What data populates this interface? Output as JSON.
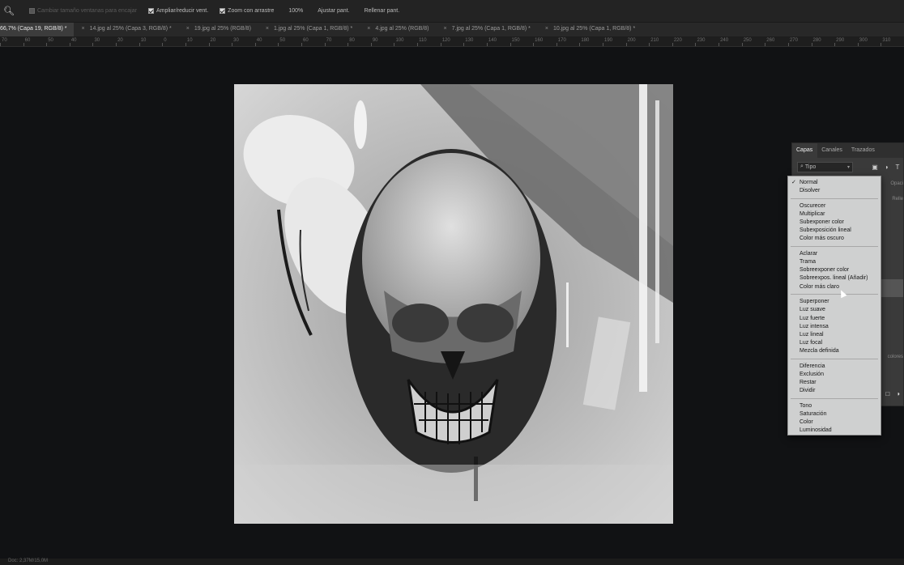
{
  "options_bar": {
    "items": [
      {
        "label": "Cambiar tamaño ventanas para encajar",
        "checked": false,
        "dimmed": true
      },
      {
        "label": "Ampliar/reducir vent.",
        "checked": true,
        "dimmed": false
      },
      {
        "label": "Zoom con arrastre",
        "checked": true,
        "dimmed": false
      }
    ],
    "buttons": [
      "100%",
      "Ajustar pant.",
      "Rellenar pant."
    ]
  },
  "document_tabs": [
    {
      "label": "66,7% (Capa 19, RGB/8) *",
      "active": true
    },
    {
      "label": "14.jpg al 25% (Capa 3, RGB/8) *",
      "active": false
    },
    {
      "label": "19.jpg al 25% (RGB/8)",
      "active": false
    },
    {
      "label": "1.jpg al 25% (Capa 1, RGB/8) *",
      "active": false
    },
    {
      "label": "4.jpg al 25% (RGB/8)",
      "active": false
    },
    {
      "label": "7.jpg al 25% (Capa 1, RGB/8) *",
      "active": false
    },
    {
      "label": "10.jpg al 25% (Capa 1, RGB/8) *",
      "active": false
    }
  ],
  "ruler_labels": [
    "70",
    "60",
    "50",
    "40",
    "30",
    "20",
    "10",
    "0",
    "10",
    "20",
    "30",
    "40",
    "50",
    "60",
    "70",
    "80",
    "90",
    "100",
    "110",
    "120",
    "130",
    "140",
    "150",
    "160",
    "170",
    "180",
    "190",
    "200",
    "210",
    "220",
    "230",
    "240",
    "250",
    "260",
    "270",
    "280",
    "290",
    "300",
    "310"
  ],
  "layers_panel": {
    "tabs": [
      "Capas",
      "Canales",
      "Trazados"
    ],
    "filter_label": "Tipo",
    "opacity_label": "Opaci",
    "fill_label": "Relle",
    "colors_label": "colores"
  },
  "blend_menu": {
    "selected": "Normal",
    "groups": [
      [
        "Normal",
        "Disolver"
      ],
      [
        "Oscurecer",
        "Multiplicar",
        "Subexponer color",
        "Subexposición lineal",
        "Color más oscuro"
      ],
      [
        "Aclarar",
        "Trama",
        "Sobreexponer color",
        "Sobreexpos. lineal (Añadir)",
        "Color más claro"
      ],
      [
        "Superponer",
        "Luz suave",
        "Luz fuerte",
        "Luz intensa",
        "Luz lineal",
        "Luz focal",
        "Mezcla definida"
      ],
      [
        "Diferencia",
        "Exclusión",
        "Restar",
        "Dividir"
      ],
      [
        "Tono",
        "Saturación",
        "Color",
        "Luminosidad"
      ]
    ]
  },
  "status": {
    "text": "Doc: 2,37M/15,0M"
  },
  "colors": {
    "canvas_bg": "#111214",
    "menu_bg": "#cfd0d0",
    "panel_bg": "#3a3a3a"
  },
  "icons": [
    "zoom-tool-icon",
    "search-icon",
    "image-filter-icon",
    "adjustment-filter-icon",
    "type-filter-icon",
    "checkmark-icon",
    "cursor-arrow-icon"
  ]
}
